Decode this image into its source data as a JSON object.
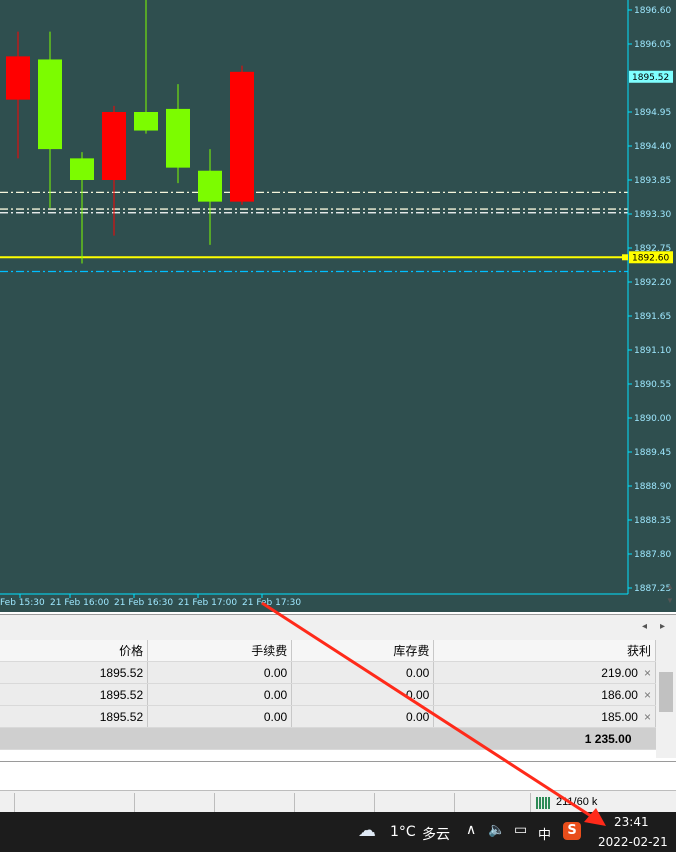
{
  "chart": {
    "background": "#2f4f4f",
    "bull_color": "#7cfc00",
    "bear_color": "#ff0000",
    "axis_color": "#00e0ff",
    "price_ticks": [
      "1896.60",
      "1896.05",
      "1895.52",
      "1894.95",
      "1894.40",
      "1893.85",
      "1893.30",
      "1892.75",
      "1892.60",
      "1892.20",
      "1891.65",
      "1891.10",
      "1890.55",
      "1890.00",
      "1889.45",
      "1888.90",
      "1888.35",
      "1887.80",
      "1887.25"
    ],
    "current_price_label": "1895.52",
    "bid_line_label": "1892.60",
    "time_labels": [
      "Feb 15:30",
      "21 Feb 16:00",
      "21 Feb 16:30",
      "21 Feb 17:00",
      "21 Feb 17:30"
    ]
  },
  "chart_data": {
    "type": "candlestick",
    "series": [
      {
        "open": 1895.85,
        "high": 1896.25,
        "low": 1894.2,
        "close": 1895.15
      },
      {
        "open": 1894.35,
        "high": 1896.25,
        "low": 1893.4,
        "close": 1895.8
      },
      {
        "open": 1893.85,
        "high": 1894.3,
        "low": 1892.5,
        "close": 1894.2
      },
      {
        "open": 1894.95,
        "high": 1895.05,
        "low": 1892.95,
        "close": 1893.85
      },
      {
        "open": 1894.65,
        "high": 1896.85,
        "low": 1894.6,
        "close": 1894.95
      },
      {
        "open": 1894.05,
        "high": 1895.4,
        "low": 1893.8,
        "close": 1895.0
      },
      {
        "open": 1893.5,
        "high": 1894.35,
        "low": 1892.8,
        "close": 1894.0
      },
      {
        "open": 1895.6,
        "high": 1895.7,
        "low": 1893.45,
        "close": 1893.5
      }
    ],
    "price_range": [
      1887.25,
      1896.6
    ],
    "horizontal_lines": [
      {
        "price": 1893.65,
        "style": "dash-dot",
        "color": "#f5f5dc"
      },
      {
        "price": 1893.38,
        "style": "dash-dot",
        "color": "#f5f5dc"
      },
      {
        "price": 1893.32,
        "style": "dash-dot",
        "color": "#ffffff"
      },
      {
        "price": 1892.6,
        "style": "solid",
        "color": "#ffff00"
      },
      {
        "price": 1892.37,
        "style": "dash-dot",
        "color": "#00bfff"
      }
    ]
  },
  "table": {
    "headers": [
      "价格",
      "手续费",
      "库存费",
      "获利"
    ],
    "rows": [
      {
        "price": "1895.52",
        "fee": "0.00",
        "swap": "0.00",
        "profit": "219.00"
      },
      {
        "price": "1895.52",
        "fee": "0.00",
        "swap": "0.00",
        "profit": "186.00"
      },
      {
        "price": "1895.52",
        "fee": "0.00",
        "swap": "0.00",
        "profit": "185.00"
      }
    ],
    "total_profit": "1 235.00",
    "close_icon": "×"
  },
  "status": {
    "traffic": "211/60 k"
  },
  "taskbar": {
    "weather_temp": "1°C",
    "weather_desc": "多云",
    "ime": "中",
    "time": "23:41",
    "date": "2022-02-21",
    "ime_logo": "S"
  }
}
